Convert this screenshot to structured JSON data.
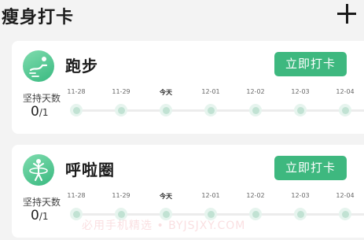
{
  "header": {
    "title": "瘦身打卡",
    "add_icon": "plus-icon"
  },
  "activities": [
    {
      "name": "跑步",
      "icon": "running-icon",
      "checkin_label": "立即打卡",
      "streak_label": "坚持天数",
      "streak_done": "0",
      "streak_total": "/1",
      "days": [
        "11-28",
        "11-29",
        "今天",
        "12-01",
        "12-02",
        "12-03",
        "12-04"
      ]
    },
    {
      "name": "呼啦圈",
      "icon": "hula-hoop-icon",
      "checkin_label": "立即打卡",
      "streak_label": "坚持天数",
      "streak_done": "0",
      "streak_total": "/1",
      "days": [
        "11-28",
        "11-29",
        "今天",
        "12-01",
        "12-02",
        "12-03",
        "12-04"
      ]
    }
  ],
  "watermark": "必用手机精选 • BYJSJXY.COM",
  "colors": {
    "accent": "#3eb87f",
    "dot": "#c1e2d3",
    "background": "#f3f3f3"
  }
}
